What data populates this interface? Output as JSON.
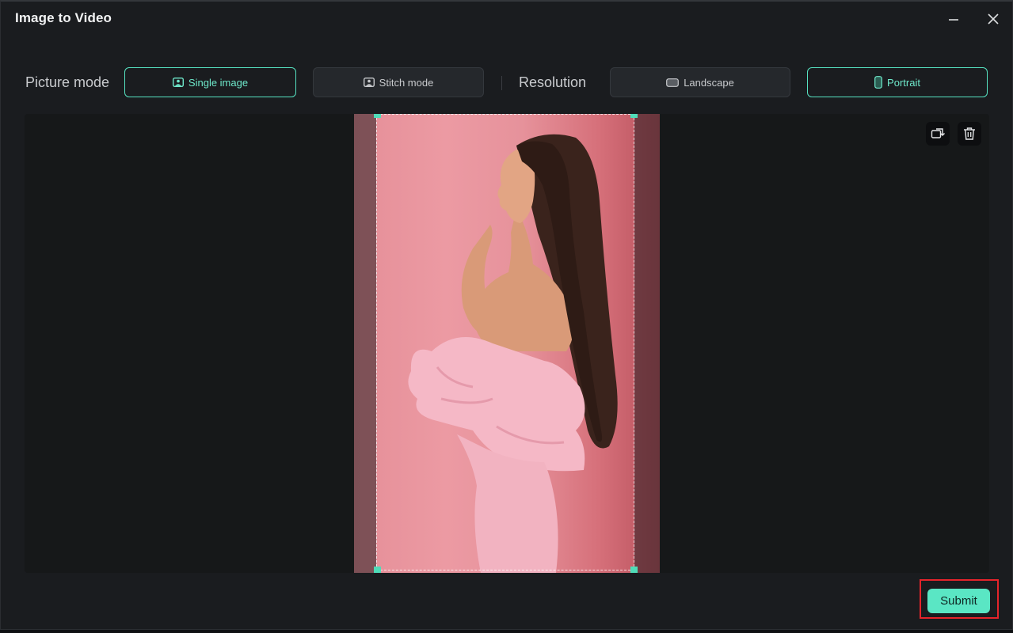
{
  "window": {
    "title": "Image to Video"
  },
  "toolbar": {
    "picture_mode_label": "Picture mode",
    "single_image_label": "Single image",
    "stitch_mode_label": "Stitch mode",
    "resolution_label": "Resolution",
    "landscape_label": "Landscape",
    "portrait_label": "Portrait",
    "active_picture_mode": "Single image",
    "active_resolution": "Portrait"
  },
  "canvas": {
    "tools": [
      "replace-image-icon",
      "trash-icon"
    ]
  },
  "footer": {
    "submit_label": "Submit"
  },
  "colors": {
    "accent": "#56e2c1",
    "submit_bg": "#5ae6c4",
    "highlight": "#e5242b",
    "window_bg": "#1a1c1f"
  }
}
